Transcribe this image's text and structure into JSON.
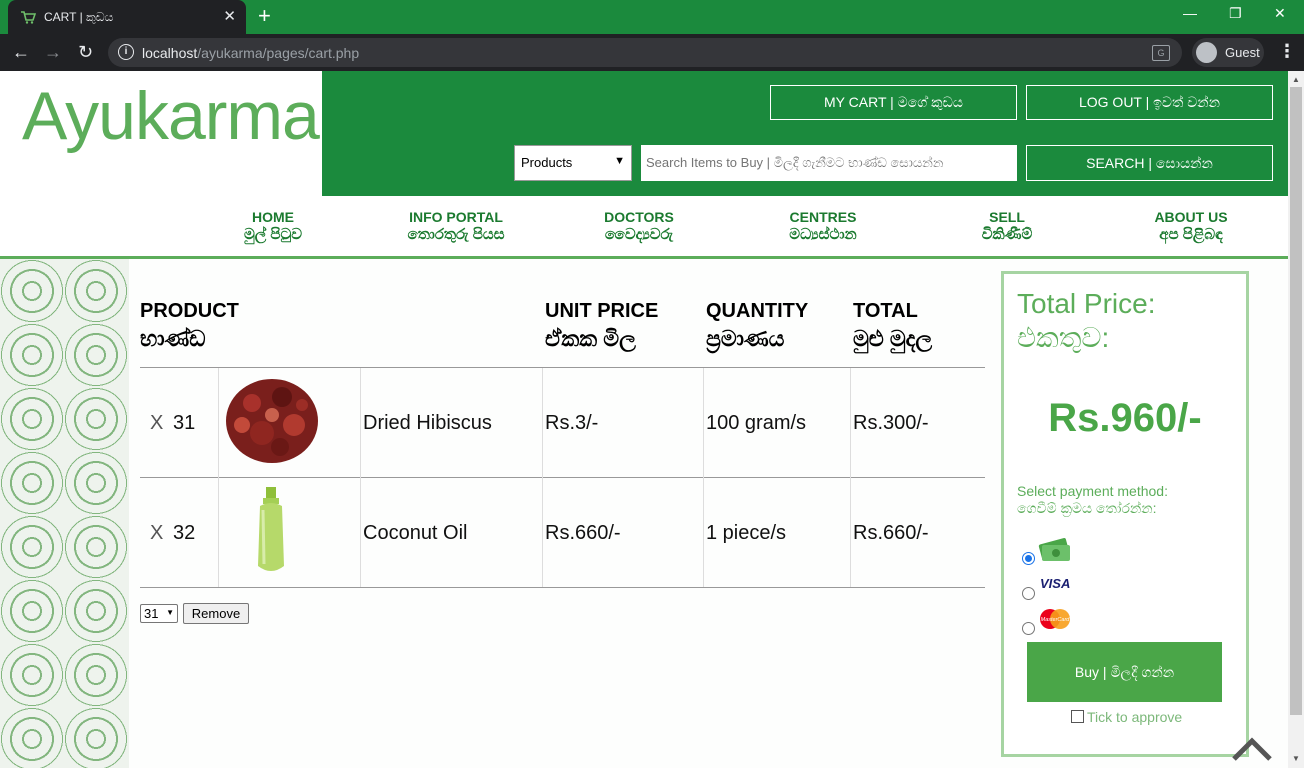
{
  "browser": {
    "tab_title": "CART | කුඩය",
    "new_tab": "+",
    "url_host": "localhost",
    "url_path": "/ayukarma/pages/cart.php",
    "profile_name": "Guest",
    "translate_label": "G"
  },
  "header": {
    "logo": "Ayukarma",
    "my_cart": "MY CART  |  මගේ කුඩය",
    "logout": "LOG OUT  |  ඉවත් වන්න",
    "category_selected": "Products",
    "search_placeholder": "Search Items to Buy | මිලදී ගැනීමට භාණ්ඩ සොයන්න",
    "search_button": "SEARCH  |  සොයන්න"
  },
  "nav": [
    {
      "en": "HOME",
      "si": "මුල් පිටුව"
    },
    {
      "en": "INFO PORTAL",
      "si": "තොරතුරු පියස"
    },
    {
      "en": "DOCTORS",
      "si": "වෛද්‍යවරු"
    },
    {
      "en": "CENTRES",
      "si": "මධ්‍යස්ථාන"
    },
    {
      "en": "SELL",
      "si": "විකිණීම්"
    },
    {
      "en": "ABOUT US",
      "si": "අප පිළිබඳ"
    }
  ],
  "cart": {
    "headers": [
      {
        "en": "PRODUCT",
        "si": "භාණ්ඩ"
      },
      {
        "en": "UNIT PRICE",
        "si": "ඒකක මිල"
      },
      {
        "en": "QUANTITY",
        "si": "ප්‍රමාණය"
      },
      {
        "en": "TOTAL",
        "si": "මුළු මුදල"
      }
    ],
    "rows": [
      {
        "remove": "X",
        "id": "31",
        "name": "Dried Hibiscus",
        "unit_price": "Rs.3/-",
        "quantity": "100 gram/s",
        "total": "Rs.300/-",
        "image": "dried-hibiscus-image"
      },
      {
        "remove": "X",
        "id": "32",
        "name": "Coconut Oil",
        "unit_price": "Rs.660/-",
        "quantity": "1 piece/s",
        "total": "Rs.660/-",
        "image": "coconut-oil-bottle-image"
      }
    ],
    "remove_select_value": "31",
    "remove_button": "Remove"
  },
  "summary": {
    "title_en": "Total Price:",
    "title_si": "එකතුව:",
    "amount": "Rs.960/-",
    "payment_label_en": "Select payment method:",
    "payment_label_si": "ගෙවීම් ක්‍රමය තෝරන්න:",
    "payment_methods": [
      {
        "name": "cash-icon",
        "selected": true
      },
      {
        "name": "visa-icon",
        "label": "VISA",
        "selected": false
      },
      {
        "name": "mastercard-icon",
        "label": "MasterCard",
        "selected": false
      }
    ],
    "buy_button": "Buy | මිලදී ගන්න",
    "approve_label": "Tick to approve",
    "approved": false
  },
  "colors": {
    "brand_green": "#1b8a3d",
    "accent_green": "#4aa648",
    "logo_green": "#5cad5a"
  }
}
